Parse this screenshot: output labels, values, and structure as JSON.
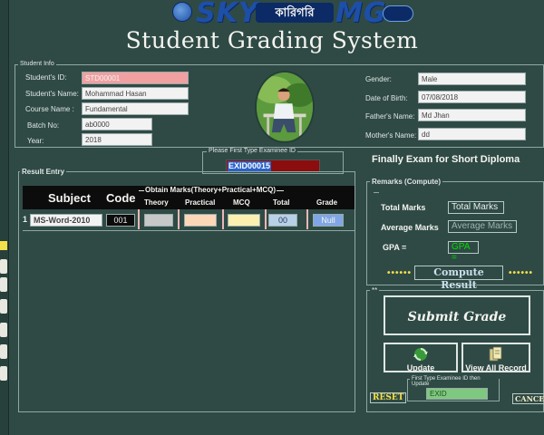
{
  "app": {
    "logo_text": "SKY",
    "logo_mark": "কারিগরি",
    "logo_tail": "MG",
    "title": "Student Grading System"
  },
  "student_info": {
    "group_label": "Student Info",
    "labels": {
      "student_id": "Student's ID:",
      "student_name": "Student's Name:",
      "course_name": "Course Name :",
      "batch_no": "Batch No:",
      "year": "Year:",
      "gender": "Gender:",
      "dob": "Date of Birth:",
      "father_name": "Father's Name:",
      "mother_name": "Mother's Name:"
    },
    "values": {
      "student_id": "STD00001",
      "student_name": "Mohammad Hasan",
      "course_name": "Fundamental",
      "batch_no": "ab0000",
      "year": "2018",
      "gender": "Male",
      "dob": "07/08/2018",
      "father_name": "Md Jhan",
      "mother_name": "dd"
    }
  },
  "examinee": {
    "group_label": "Please First Type Examinee ID",
    "value": "EXID00015"
  },
  "exam_title": "Finally Exam for Short Diploma",
  "result_entry": {
    "group_label": "Result Entry",
    "headers": {
      "subject": "Subject",
      "code": "Code",
      "obtain_marks": "Obtain Marks(Theory+Practical+MCQ)",
      "theory": "Theory",
      "practical": "Practical",
      "mcq": "MCQ",
      "total": "Total",
      "grade": "Grade"
    },
    "rows": [
      {
        "index": "1",
        "subject": "MS-Word-2010",
        "code": "001",
        "theory": "",
        "practical": "",
        "mcq": "",
        "total": "00",
        "grade": "Null"
      }
    ]
  },
  "remarks": {
    "group_label": "Remarks (Compute)",
    "total_marks_label": "Total Marks",
    "total_marks_value": "Total Marks",
    "average_label": "Average Marks",
    "average_value": "Average Marks",
    "gpa_label": "GPA =",
    "gpa_value": "GPA =",
    "compute_label": "Compute Result",
    "dots": "••••••"
  },
  "actions": {
    "group_label": "**",
    "submit_label": "Submit Grade",
    "update_label": "Update",
    "view_all_label": "View All Record",
    "reset_label": "RESET",
    "cancel_label": "CANCEL",
    "update_group_label": "First Type Examinee ID then Update",
    "update_field_value": "EXID"
  },
  "colors": {
    "background": "#2f4a45",
    "accent_yellow": "#f4e04a",
    "accent_green": "#00e000",
    "id_input_red": "#8b0d0d",
    "selection_blue": "#2c62c9"
  }
}
